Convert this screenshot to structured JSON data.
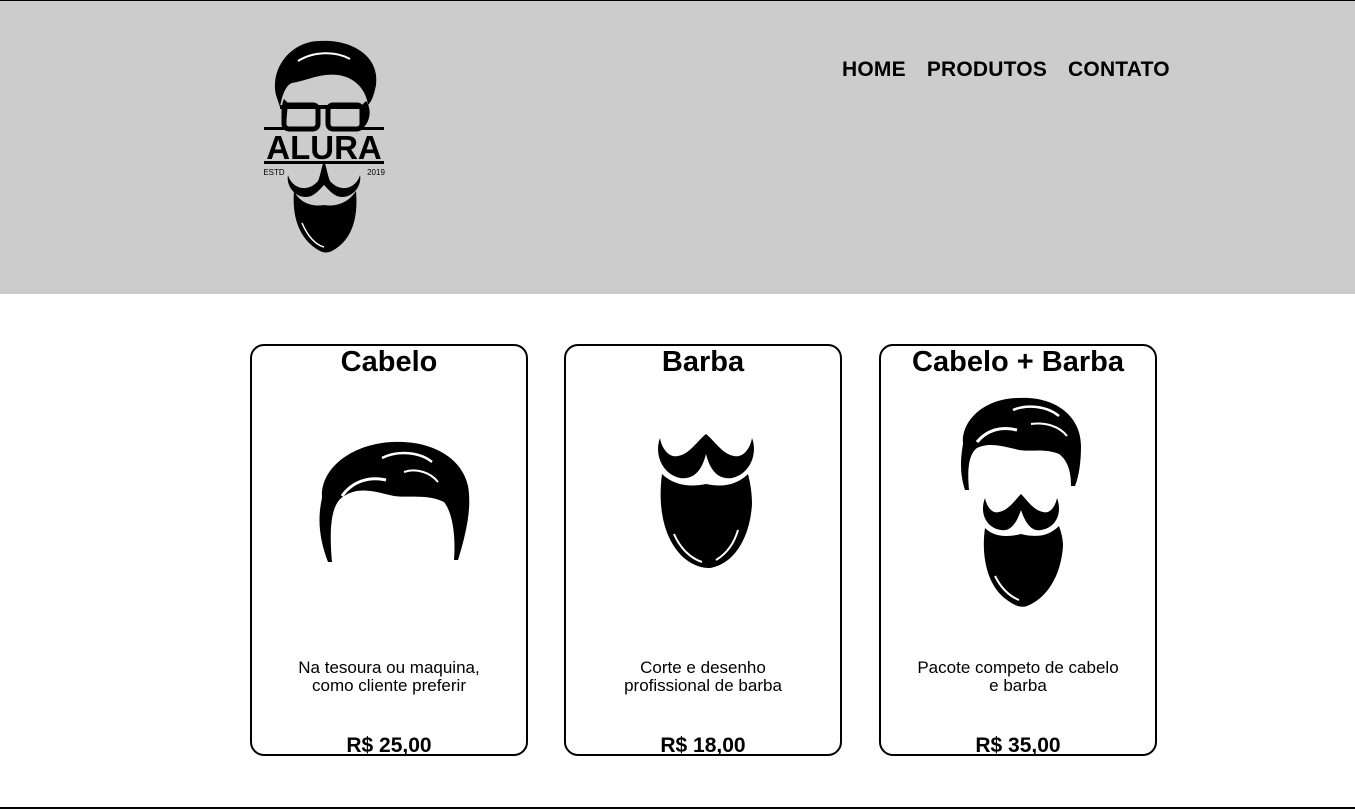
{
  "header": {
    "logo": {
      "brand": "ALURA",
      "left_text": "ESTD",
      "right_text": "2019",
      "icon": "bearded-man-logo-icon"
    },
    "nav": [
      {
        "label": "HOME"
      },
      {
        "label": "PRODUTOS"
      },
      {
        "label": "CONTATO"
      }
    ]
  },
  "products": [
    {
      "title": "Cabelo",
      "description": "Na tesoura ou maquina, como cliente preferir",
      "price": "R$ 25,00",
      "icon": "hair-icon"
    },
    {
      "title": "Barba",
      "description": "Corte e desenho profissional de barba",
      "price": "R$ 18,00",
      "icon": "beard-icon"
    },
    {
      "title": "Cabelo + Barba",
      "description": "Pacote competo de cabelo e barba",
      "price": "R$ 35,00",
      "icon": "hair-and-beard-icon"
    }
  ],
  "colors": {
    "header_bg": "#cccccc",
    "page_bg": "#ffffff",
    "text": "#000000",
    "border": "#000000"
  }
}
